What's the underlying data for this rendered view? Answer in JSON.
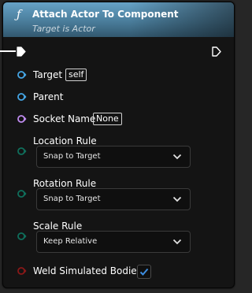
{
  "node": {
    "title": "Attach Actor To Component",
    "subtitle": "Target is Actor",
    "icon": "function-icon",
    "header_color": "#4f86a6"
  },
  "pins": {
    "target": {
      "label": "Target",
      "default": "self",
      "color": "#45a6e6"
    },
    "parent": {
      "label": "Parent",
      "color": "#45a6e6"
    },
    "socket_name": {
      "label": "Socket Name",
      "default": "None",
      "color": "#c08cf0"
    },
    "location_rule": {
      "label": "Location Rule",
      "value": "Snap to Target",
      "color": "#0f6f5c"
    },
    "rotation_rule": {
      "label": "Rotation Rule",
      "value": "Snap to Target",
      "color": "#0f6f5c"
    },
    "scale_rule": {
      "label": "Scale Rule",
      "value": "Keep Relative",
      "color": "#0f6f5c"
    },
    "weld": {
      "label": "Weld Simulated Bodies",
      "checked": true,
      "color": "#8a1818"
    }
  }
}
